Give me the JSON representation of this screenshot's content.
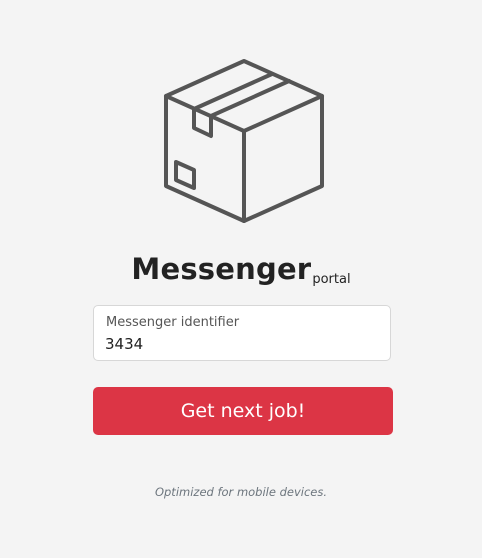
{
  "logo": {
    "icon": "package-box-icon",
    "stroke_color": "#555555"
  },
  "title": {
    "main": "Messenger",
    "sub": "portal"
  },
  "form": {
    "field_label": "Messenger identifier",
    "field_value": "3434",
    "submit_label": "Get next job!"
  },
  "footer": {
    "note": "Optimized for mobile devices."
  },
  "colors": {
    "background": "#f4f4f4",
    "button": "#dc3545",
    "button_text": "#ffffff",
    "note_text": "#6c757d"
  }
}
